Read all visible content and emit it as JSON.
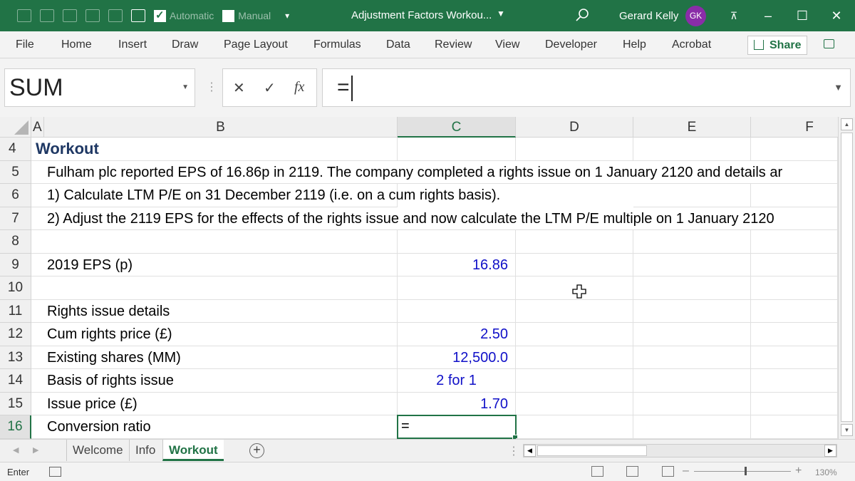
{
  "titlebar": {
    "autosave_label": "Automatic",
    "manual_label": "Manual",
    "document_title": "Adjustment Factors Workou...",
    "user_name": "Gerard Kelly",
    "user_initials": "GK"
  },
  "ribbon": {
    "tabs": [
      "File",
      "Home",
      "Insert",
      "Draw",
      "Page Layout",
      "Formulas",
      "Data",
      "Review",
      "View",
      "Developer",
      "Help",
      "Acrobat"
    ],
    "share_label": "Share"
  },
  "formula_bar": {
    "name_box": "SUM",
    "formula": "=",
    "fx": "fx"
  },
  "columns": [
    "A",
    "B",
    "C",
    "D",
    "E",
    "F"
  ],
  "rows": [
    {
      "num": "4",
      "b": "Workout",
      "c": ""
    },
    {
      "num": "5",
      "b": "Fulham plc reported EPS of 16.86p in 2119. The company completed a rights issue on 1 January 2120 and details ar",
      "c": ""
    },
    {
      "num": "6",
      "b": "1) Calculate LTM P/E on 31 December 2119 (i.e. on a cum rights basis).",
      "c": ""
    },
    {
      "num": "7",
      "b": "2) Adjust the 2119 EPS for the effects of the rights issue and now calculate the LTM P/E multiple on 1 January 2120",
      "c": ""
    },
    {
      "num": "8",
      "b": "",
      "c": ""
    },
    {
      "num": "9",
      "b": "2019 EPS (p)",
      "c": "16.86"
    },
    {
      "num": "10",
      "b": "",
      "c": ""
    },
    {
      "num": "11",
      "b": "Rights issue details",
      "c": ""
    },
    {
      "num": "12",
      "b": "Cum rights price (£)",
      "c": "2.50"
    },
    {
      "num": "13",
      "b": "Existing shares (MM)",
      "c": "12,500.0"
    },
    {
      "num": "14",
      "b": "Basis of rights issue",
      "c": "2 for 1"
    },
    {
      "num": "15",
      "b": "Issue price (£)",
      "c": "1.70"
    },
    {
      "num": "16",
      "b": "Conversion ratio",
      "c": "="
    }
  ],
  "sheet_tabs": [
    "Welcome",
    "Info",
    "Workout"
  ],
  "status": {
    "mode": "Enter",
    "zoom": "130%"
  },
  "colors": {
    "accent": "#217346",
    "input_blue": "#1010c8",
    "title_navy": "#1f3864",
    "avatar": "#8a2da8"
  }
}
